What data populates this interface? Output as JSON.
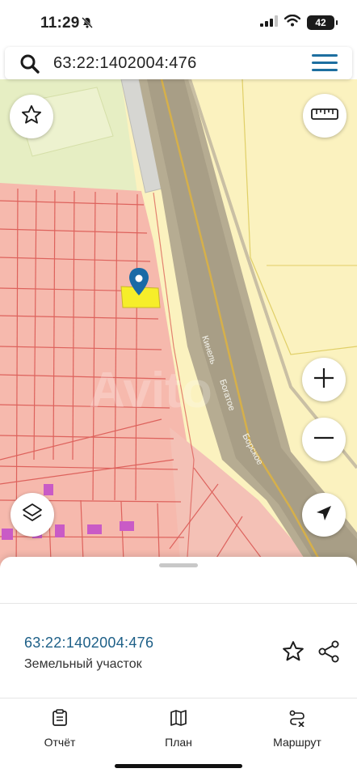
{
  "status_bar": {
    "time": "11:29",
    "battery": "42"
  },
  "search": {
    "query": "63:22:1402004:476"
  },
  "map": {
    "road_labels": [
      "Кинель",
      "Богатое",
      "Борское"
    ],
    "watermark": "Avito"
  },
  "map_controls": {
    "favorite": "star-icon",
    "ruler": "ruler-icon",
    "zoom_in": "plus-icon",
    "zoom_out": "minus-icon",
    "layers": "layers-icon",
    "locate": "navigation-arrow-icon"
  },
  "parcel": {
    "cadastral_number": "63:22:1402004:476",
    "type": "Земельный участок"
  },
  "bottom_nav": {
    "tabs": [
      {
        "label": "Отчёт",
        "icon": "report-icon"
      },
      {
        "label": "План",
        "icon": "map-book-icon"
      },
      {
        "label": "Маршрут",
        "icon": "route-icon"
      }
    ]
  },
  "colors": {
    "accent": "#1d5f87",
    "pin": "#1a6aa6",
    "parcel_fill": "#f6ee2a",
    "residential_fill": "#f6b8ad",
    "road": "#a89e86",
    "park": "#e8efc5"
  }
}
